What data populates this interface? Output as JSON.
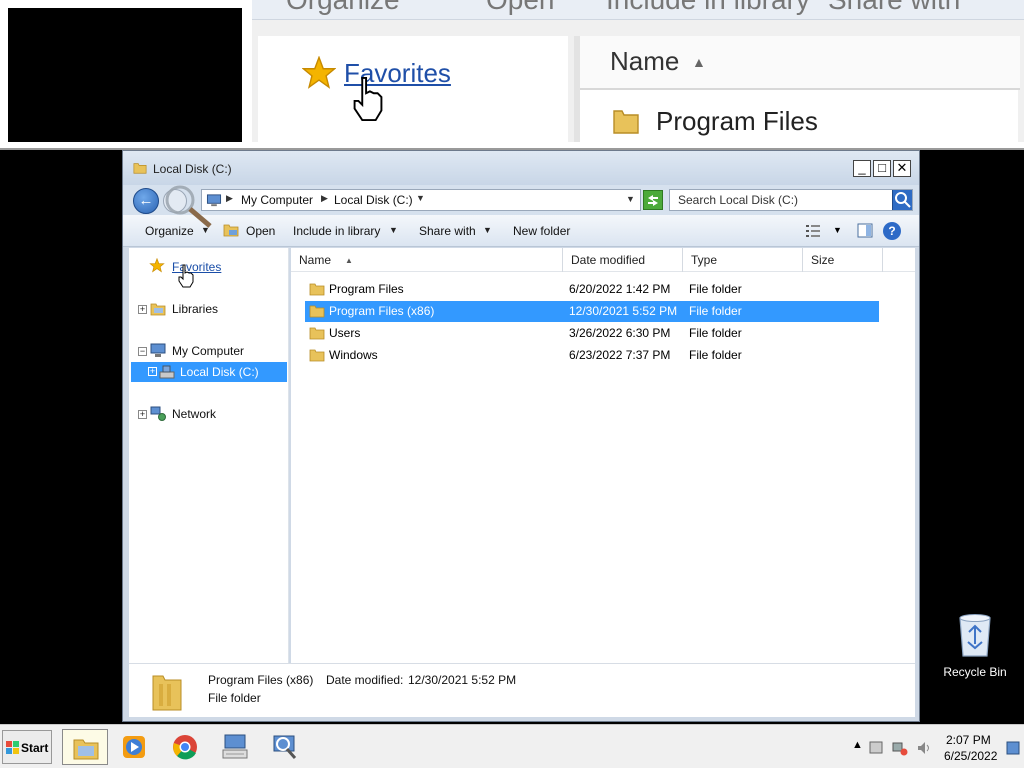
{
  "magnifier": {
    "toolbar_fragments": [
      "Organize",
      "Open",
      "Include in library",
      "Share with"
    ],
    "nav_favorites": "Favorites",
    "column_name": "Name",
    "row_name": "Program Files"
  },
  "window": {
    "title": "Local Disk (C:)",
    "controls": {
      "minimize": "_",
      "maximize": "□",
      "close": "✕"
    },
    "address": {
      "crumbs": [
        "My Computer",
        "Local Disk (C:)"
      ],
      "search_placeholder": "Search Local Disk (C:)"
    },
    "commands": {
      "organize": "Organize",
      "open": "Open",
      "include_in_library": "Include in library",
      "share_with": "Share with",
      "new_folder": "New folder",
      "help": "?"
    },
    "nav": {
      "favorites": "Favorites",
      "libraries": "Libraries",
      "my_computer": "My Computer",
      "local_disk": "Local Disk (C:)",
      "network": "Network"
    },
    "columns": {
      "name": "Name",
      "date_modified": "Date modified",
      "type": "Type",
      "size": "Size"
    },
    "rows": [
      {
        "name": "Program Files",
        "date": "6/20/2022 1:42 PM",
        "type": "File folder",
        "selected": false
      },
      {
        "name": "Program Files (x86)",
        "date": "12/30/2021 5:52 PM",
        "type": "File folder",
        "selected": true
      },
      {
        "name": "Users",
        "date": "3/26/2022 6:30 PM",
        "type": "File folder",
        "selected": false
      },
      {
        "name": "Windows",
        "date": "6/23/2022 7:37 PM",
        "type": "File folder",
        "selected": false
      }
    ],
    "details": {
      "name": "Program Files (x86)",
      "date_label": "Date modified:",
      "date_value": "12/30/2021 5:52 PM",
      "type": "File folder"
    }
  },
  "desktop": {
    "recycle_bin": "Recycle Bin"
  },
  "taskbar": {
    "start": "Start",
    "pinned": [
      "folder-icon",
      "media-player-icon",
      "chrome-icon",
      "keyboard-icon",
      "magnifier-icon"
    ],
    "time": "2:07 PM",
    "date": "6/25/2022"
  },
  "colors": {
    "selection": "#3399ff",
    "link": "#1a4ea8"
  }
}
